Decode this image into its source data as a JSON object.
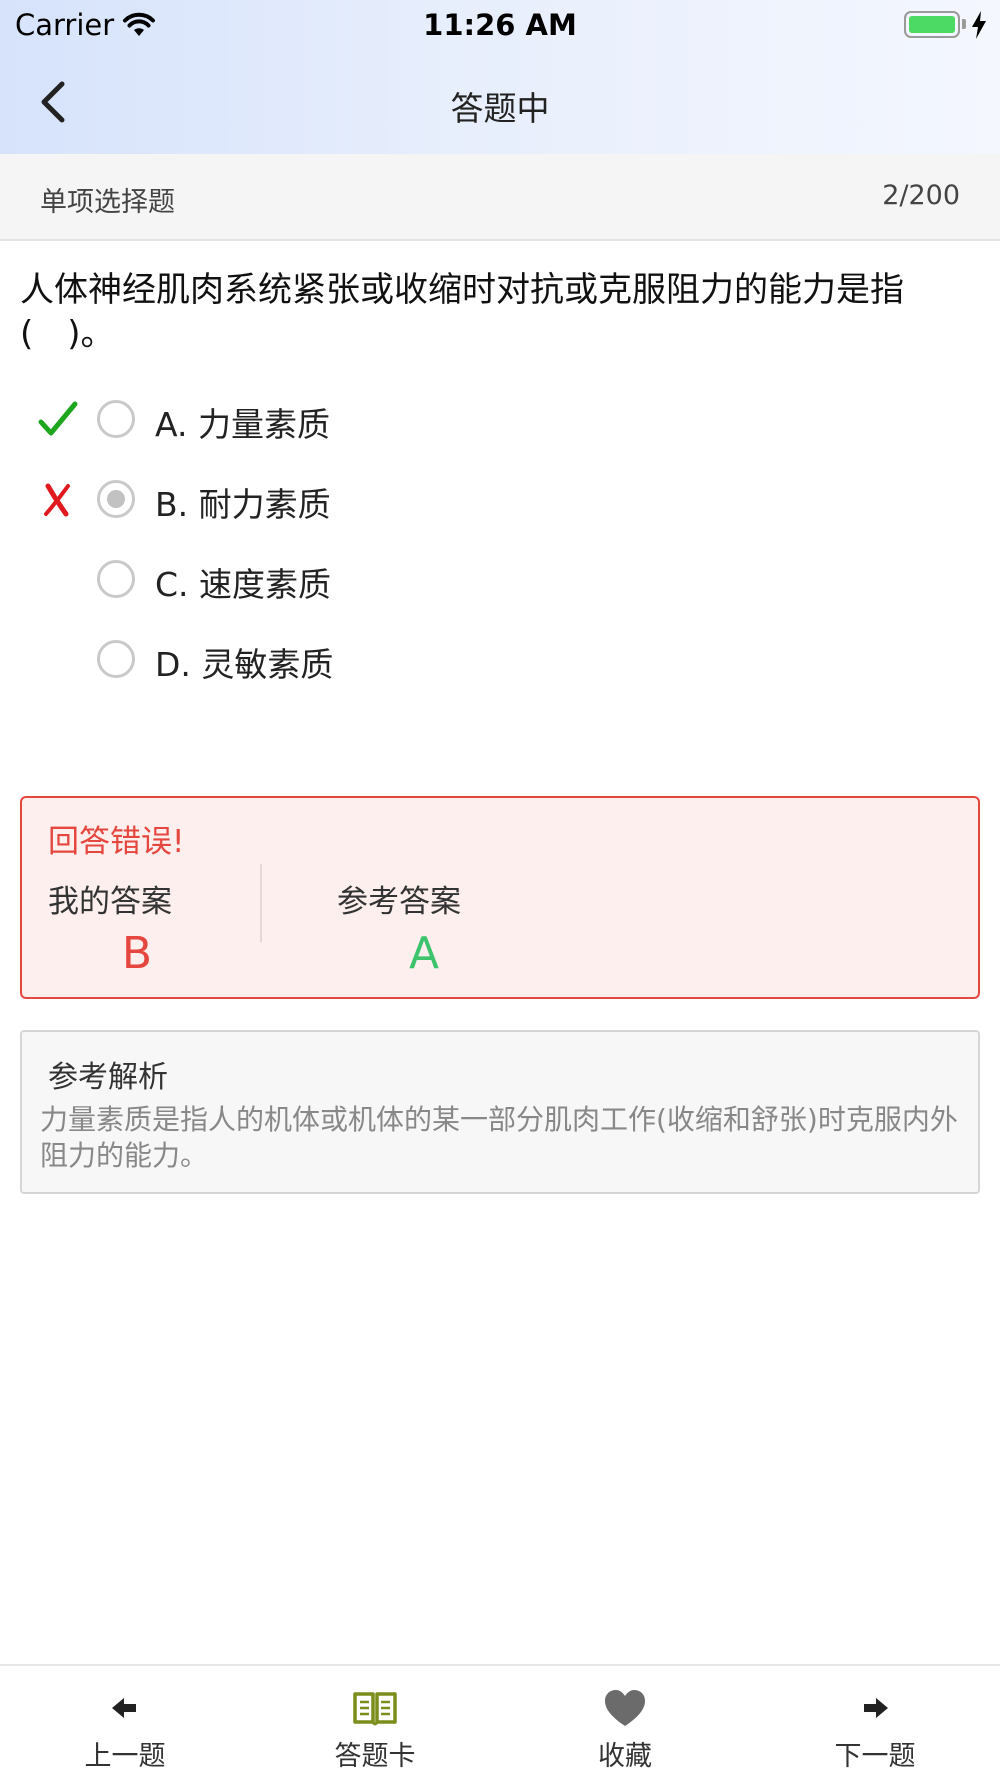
{
  "status_bar": {
    "carrier": "Carrier",
    "time": "11:26 AM",
    "battery_color": "#4cd964"
  },
  "nav": {
    "title": "答题中",
    "back_icon": "chevron-left-icon"
  },
  "question": {
    "type": "单项选择题",
    "progress": "2/200",
    "text": "人体神经肌肉系统紧张或收缩时对抗或克服阻力的能力是指(　)。"
  },
  "options": [
    {
      "label": "A. 力量素质",
      "selected": false,
      "mark": "correct"
    },
    {
      "label": "B. 耐力素质",
      "selected": true,
      "mark": "wrong"
    },
    {
      "label": "C. 速度素质",
      "selected": false,
      "mark": ""
    },
    {
      "label": "D. 灵敏素质",
      "selected": false,
      "mark": ""
    }
  ],
  "result": {
    "title": "回答错误!",
    "my_answer_label": "我的答案",
    "my_answer": "B",
    "ref_answer_label": "参考答案",
    "ref_answer": "A",
    "error_color": "#e5463d",
    "correct_color": "#3cc36c"
  },
  "analysis": {
    "title": "参考解析",
    "text": "力量素质是指人的机体或机体的某一部分肌肉工作(收缩和舒张)时克服内外阻力的能力。"
  },
  "tabbar": {
    "items": [
      {
        "label": "上一题",
        "icon": "arrow-left-icon"
      },
      {
        "label": "答题卡",
        "icon": "book-icon",
        "color": "#7c8d1c"
      },
      {
        "label": "收藏",
        "icon": "heart-icon"
      },
      {
        "label": "下一题",
        "icon": "arrow-right-icon"
      }
    ]
  }
}
